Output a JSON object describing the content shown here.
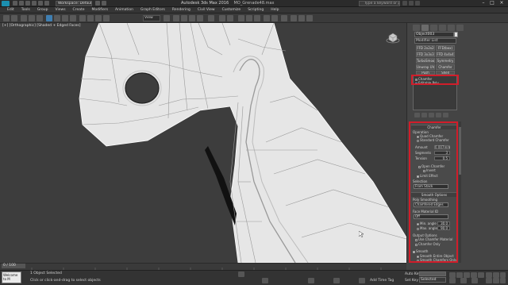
{
  "title_bar": {
    "workspace": "Workspace: Default",
    "app": "Autodesk 3ds Max 2016",
    "file": "MO_Grenade48.max",
    "search_placeholder": "Type a keyword or phrase"
  },
  "menu": [
    "Edit",
    "Tools",
    "Group",
    "Views",
    "Create",
    "Modifiers",
    "Animation",
    "Graph Editors",
    "Rendering",
    "Civil View",
    "Customize",
    "Scripting",
    "Help"
  ],
  "toolbar": {
    "view_dropdown": "View"
  },
  "viewport": {
    "label": "[+] [Orthographic] [Shaded + Edged Faces]"
  },
  "command_panel": {
    "object_name": "Object003",
    "modifier_list": "Modifier List",
    "modifier_buttons": [
      "FFD 2x2x2",
      "FFD(box)",
      "FFD 3x3x3",
      "FFD 4x4x4",
      "TurboSmooth",
      "Symmetry",
      "Unwrap UVW",
      "Chamfer",
      "Push",
      "Shell"
    ],
    "stack": [
      "Chamfer",
      "Editable Poly"
    ]
  },
  "chamfer_rollout": {
    "title": "Chamfer",
    "operation_label": "Operation",
    "quad_chamfer": "Quad Chamfer",
    "standard_chamfer": "Standard Chamfer",
    "amount_label": "Amount",
    "amount": "0.007mm",
    "segments_label": "Segments",
    "segments": "3",
    "tension_label": "Tension",
    "tension": "0.5",
    "open_chamfer": "Open Chamfer",
    "invert": "Invert",
    "limit_effect": "Limit Effect",
    "selection_label": "Selection",
    "selection_value": "From Stack",
    "smoothing_head": "Smooth Options",
    "smoothing_label": "Poly Smoothing",
    "smoothing_value": "Chamfered Edges",
    "material_label": "Face Material ID",
    "material_value": "Off",
    "min_angle_label": "Min. angle",
    "min_angle": "30.0",
    "max_angle_label": "Max. angle",
    "max_angle": "90.0",
    "output_label": "Output Options",
    "use_chamfer_material": "Use Chamfer Material",
    "chamfer_only": "Chamfer Only",
    "smooth_label": "Smooth",
    "smooth_entire": "Smooth Entire Object",
    "smooth_chamfers_only": "Smooth Chamfers Only"
  },
  "timeline": {
    "frame": "0 / 100"
  },
  "status": {
    "maxscript": "Welcome to M",
    "selected": "1 Object Selected",
    "prompt": "Click or click-and-drag to select objects",
    "auto_key": "Auto Key",
    "set_key": "Set Key",
    "selected_dd": "Selected",
    "add_time_tag": "Add Time Tag"
  },
  "colors": {
    "highlight": "#d11d2a",
    "viewport_bg": "#3d3d3d",
    "mesh_fill": "#e6e6e6"
  }
}
